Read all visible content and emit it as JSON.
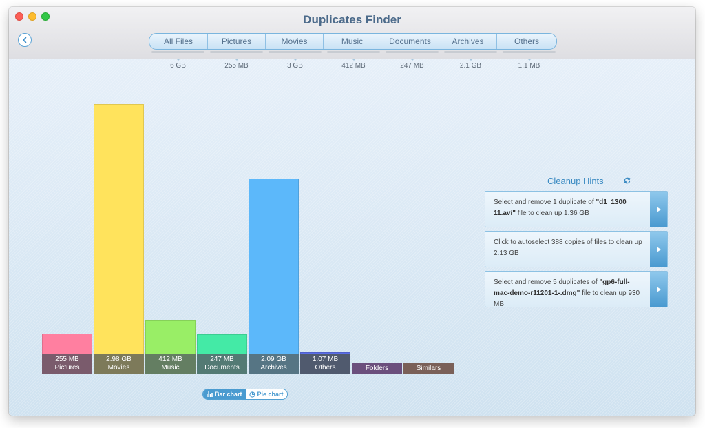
{
  "window": {
    "title": "Duplicates Finder"
  },
  "nav": {
    "back_icon": "chevron-left-icon"
  },
  "tabs": [
    {
      "label": "All Files",
      "size": "6 GB"
    },
    {
      "label": "Pictures",
      "size": "255 MB"
    },
    {
      "label": "Movies",
      "size": "3 GB"
    },
    {
      "label": "Music",
      "size": "412 MB"
    },
    {
      "label": "Documents",
      "size": "247 MB"
    },
    {
      "label": "Archives",
      "size": "2.1 GB"
    },
    {
      "label": "Others",
      "size": "1.1 MB"
    }
  ],
  "chart_data": {
    "type": "bar",
    "categories": [
      "Pictures",
      "Movies",
      "Music",
      "Documents",
      "Archives",
      "Others",
      "Folders",
      "Similars"
    ],
    "values_mb": [
      255,
      3051.5,
      412,
      247,
      2140.2,
      1.07,
      null,
      null
    ],
    "value_labels": [
      "255 MB",
      "2.98 GB",
      "412 MB",
      "247 MB",
      "2.09 GB",
      "1.07 MB",
      "",
      ""
    ],
    "colors": [
      "#ff7fa0",
      "#ffe35c",
      "#99ee66",
      "#44eaa6",
      "#5cb8fa",
      "#5b6ee8",
      "#6b4f7d",
      "#7a6058"
    ],
    "label_colors": [
      "#7a5b6c",
      "#7d7a5a",
      "#647e62",
      "#537a74",
      "#567584",
      "#505a6e",
      "#6b4f7d",
      "#7a6058"
    ]
  },
  "view_toggle": {
    "bar_label": "Bar chart",
    "pie_label": "Pie chart",
    "selected": "bar"
  },
  "hints": {
    "title": "Cleanup Hints",
    "items": [
      {
        "pre": "Select and remove 1 duplicate of ",
        "bold": "\"d1_1300 11.avi\"",
        "post": " file to clean up 1.36 GB"
      },
      {
        "pre": "Click to autoselect 388 copies of files to clean up 2.13 GB",
        "bold": "",
        "post": ""
      },
      {
        "pre": "Select and remove 5 duplicates of ",
        "bold": "\"gp6-full-mac-demo-r11201-1-.dmg\"",
        "post": " file to clean up 930 MB"
      }
    ]
  }
}
